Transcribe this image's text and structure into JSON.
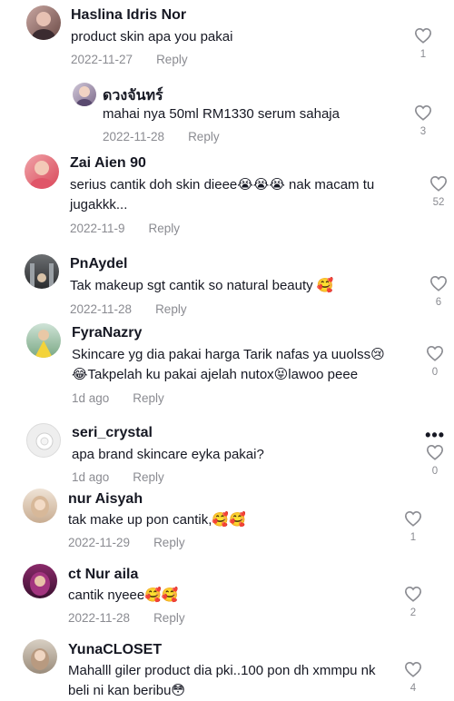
{
  "reply_label": "Reply",
  "comments": [
    {
      "name": "Haslina Idris Nor",
      "text": "product skin apa you pakai",
      "date": "2022-11-27",
      "likes": "1"
    },
    {
      "name": "ดวงจันทร์",
      "text": "mahai nya 50ml RM1330 serum sahaja",
      "date": "2022-11-28",
      "likes": "3"
    },
    {
      "name": "Zai Aien 90",
      "text": "serius cantik doh skin dieee😭😭😭 nak macam tu jugakkk...",
      "date": "2022-11-9",
      "likes": "52"
    },
    {
      "name": "PnAydel",
      "text": "Tak makeup sgt cantik so natural beauty 🥰",
      "date": "2022-11-28",
      "likes": "6"
    },
    {
      "name": "FyraNazry",
      "text": "Skincare yg dia pakai harga Tarik nafas ya uuolss😢 😂Takpelah ku pakai ajelah nutox😝lawoo peee",
      "date": "1d ago",
      "likes": "0"
    },
    {
      "name": "seri_crystal",
      "text": "apa brand skincare eyka pakai?",
      "date": "1d ago",
      "likes": "0"
    },
    {
      "name": "nur Aisyah",
      "text": "tak make up pon cantik,🥰🥰",
      "date": "2022-11-29",
      "likes": "1"
    },
    {
      "name": "ct Nur aila",
      "text": "cantik nyeee🥰🥰",
      "date": "2022-11-28",
      "likes": "2"
    },
    {
      "name": "YunaCLOSET",
      "text": "Mahalll giler product dia pki..100 pon dh xmmpu nk beli ni kan beribu😳",
      "date": "",
      "likes": "4"
    }
  ],
  "colors": {
    "text": "#161823",
    "muted": "#8a8b91"
  }
}
